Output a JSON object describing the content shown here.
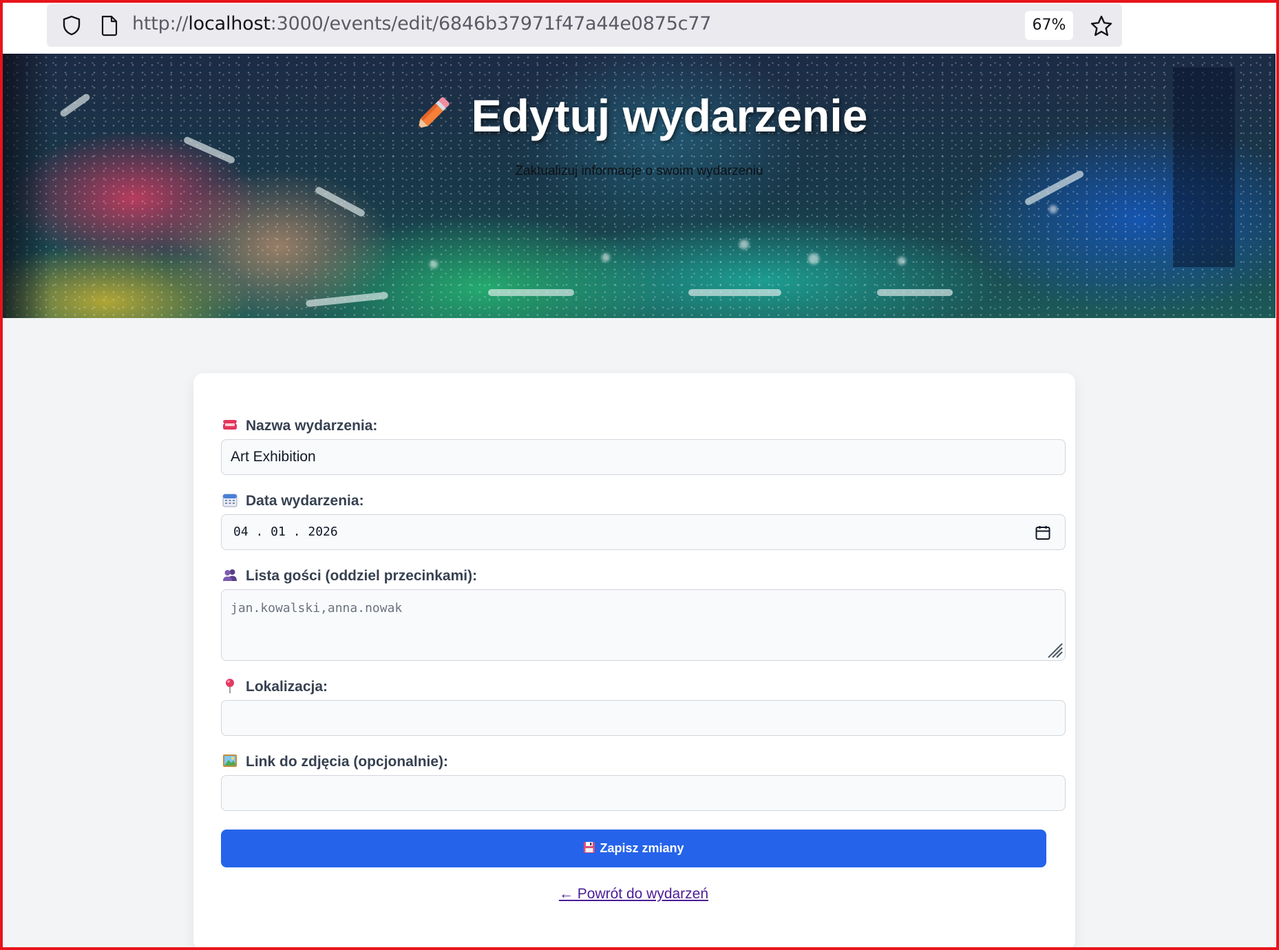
{
  "browser": {
    "url_prefix": "http://",
    "url_host": "localhost",
    "url_rest": ":3000/events/edit/6846b37971f47a44e0875c77",
    "zoom": "67%",
    "icons": [
      "shield-icon",
      "page-icon",
      "star-icon"
    ]
  },
  "hero": {
    "title": "Edytuj wydarzenie",
    "subtitle": "Zaktualizuj informacje o swoim wydarzeniu",
    "icon": "pencil-icon"
  },
  "form": {
    "name": {
      "label": "Nazwa wydarzenia:",
      "value": "Art Exhibition",
      "icon": "ticket-icon"
    },
    "date": {
      "label": "Data wydarzenia:",
      "value": "04 . 01 . 2026",
      "icon": "calendar-icon"
    },
    "guests": {
      "label": "Lista gości (oddziel przecinkami):",
      "value": "jan.kowalski,anna.nowak",
      "icon": "people-icon"
    },
    "location": {
      "label": "Lokalizacja:",
      "value": "",
      "icon": "pin-icon"
    },
    "image": {
      "label": "Link do zdjęcia (opcjonalnie):",
      "value": "",
      "icon": "picture-icon"
    },
    "save_label": "Zapisz zmiany",
    "back_label": "← Powrót do wydarzeń"
  },
  "colors": {
    "primary_button": "#2563eb",
    "page_background": "#f3f4f6",
    "frame": "#e8141b"
  }
}
